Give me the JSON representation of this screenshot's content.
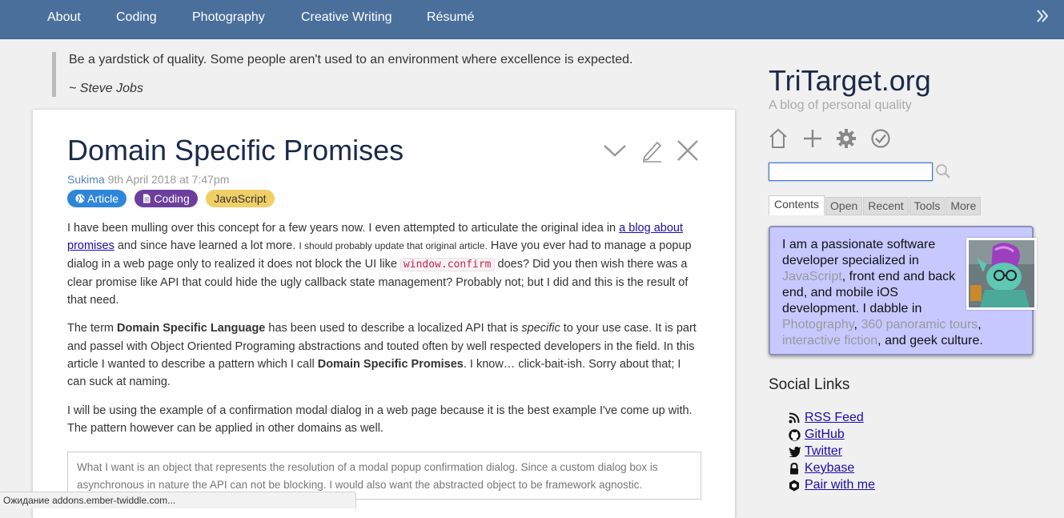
{
  "nav": {
    "items": [
      {
        "label": "About"
      },
      {
        "label": "Coding"
      },
      {
        "label": "Photography"
      },
      {
        "label": "Creative Writing"
      },
      {
        "label": "Résumé"
      }
    ],
    "expand_icon": "double-chevron-right-icon"
  },
  "quote": {
    "text": "Be a yardstick of quality. Some people aren't used to an environment where excellence is expected.",
    "cite": "~ Steve Jobs"
  },
  "article": {
    "title": "Domain Specific Promises",
    "author": "Sukima",
    "date": "9th April 2018 at 7:47pm",
    "tags": [
      {
        "label": "Article",
        "color": "#2e86d9"
      },
      {
        "label": "Coding",
        "color": "#6c3f9c"
      },
      {
        "label": "JavaScript",
        "color": "#f0cf66"
      }
    ],
    "p1": {
      "a": "I have been mulling over this concept for a few years now. I even attempted to articulate the original idea in ",
      "link": "a blog about promises",
      "b": " and since have learned a lot more. ",
      "small": "I should probably update that original article.",
      "c": " Have you ever had to manage a popup dialog in a web page only to realized it does not block the UI like ",
      "code": "window.confirm",
      "d": " does? Did you then wish there was a clear promise like API that could hide the ugly callback state management? Probably not; but I did and this is the result of that need."
    },
    "p2": {
      "a": "The term ",
      "b1": "Domain Specific Language",
      "b": " has been used to describe a localized API that is ",
      "em": "specific",
      "c": " to your use case. It is part and passel with Object Oriented Programing abstractions and touted often by well respected developers in the field. In this article I wanted to describe a pattern which I call ",
      "b2": "Domain Specific Promises",
      "d": ". I know… click-bait-ish. Sorry about that; I can suck at naming."
    },
    "p3": "I will be using the example of a confirmation modal dialog in a web page because it is the best example I've come up with. The pattern however can be applied in other domains as well.",
    "callout": "What I want is an object that represents the resolution of a modal popup confirmation dialog. Since a custom dialog box is asynchronous in nature the API can not be blocking. I would also want the abstracted object to be framework agnostic."
  },
  "sidebar": {
    "site_title": "TriTarget.org",
    "subtitle": "A blog of personal quality",
    "search": {
      "value": "",
      "placeholder": ""
    },
    "tabs": [
      {
        "label": "Contents",
        "active": true
      },
      {
        "label": "Open"
      },
      {
        "label": "Recent"
      },
      {
        "label": "Tools"
      },
      {
        "label": "More"
      }
    ],
    "about": {
      "t1": "I am a passionate software developer specialized in ",
      "l1": "JavaScript",
      "t2": ", front end and back end, and mobile iOS development. I dabble in ",
      "l2": "Photography",
      "t3": ", ",
      "l3": "360 panoramic tours",
      "t4": ", ",
      "l4": "interactive fiction",
      "t5": ", and geek culture."
    },
    "social_title": "Social Links",
    "social": [
      {
        "label": "RSS Feed",
        "icon": "rss-icon"
      },
      {
        "label": "GitHub",
        "icon": "github-icon"
      },
      {
        "label": "Twitter",
        "icon": "twitter-icon"
      },
      {
        "label": "Keybase",
        "icon": "lock-icon"
      },
      {
        "label": "Pair with me",
        "icon": "hexagon-icon"
      }
    ]
  },
  "status": "Ожидание addons.ember-twiddle.com..."
}
